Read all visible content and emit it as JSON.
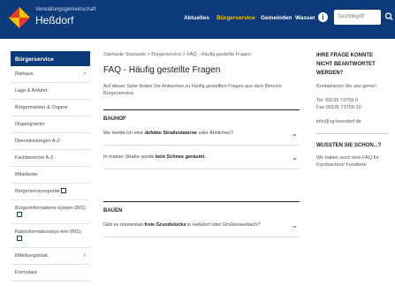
{
  "header": {
    "brand_small": "Verwaltungsgemeinschaft",
    "brand_big": "Heßdorf",
    "nav": [
      "Aktuelles",
      "Bürgerservice",
      "Gemeinden",
      "Wasser"
    ],
    "active_nav": "Bürgerservice",
    "search_placeholder": "Suchbegriff"
  },
  "sidebar": {
    "heading": "Bürgerservice",
    "items": [
      {
        "label": "Rathaus",
        "chevron": true,
        "external": false
      },
      {
        "label": "Lage & Anfahrt",
        "chevron": false,
        "external": false
      },
      {
        "label": "Bürgermeister & Organe",
        "chevron": false,
        "external": false
      },
      {
        "label": "Organigramm",
        "chevron": false,
        "external": false
      },
      {
        "label": "Dienstleistungen A-Z",
        "chevron": false,
        "external": false
      },
      {
        "label": "Fachbereiche A-Z",
        "chevron": false,
        "external": false
      },
      {
        "label": "Mitarbeiter",
        "chevron": false,
        "external": false
      },
      {
        "label": "Bürgerservicesportal",
        "chevron": false,
        "external": true
      },
      {
        "label": "Bürgerinformations-system (BIS)",
        "chevron": false,
        "external": true
      },
      {
        "label": "Ratsinformationssys-tem (RIS)",
        "chevron": false,
        "external": true
      },
      {
        "label": "Mitteilungsblatt",
        "chevron": true,
        "external": false
      },
      {
        "label": "Formulare",
        "chevron": false,
        "external": false
      }
    ]
  },
  "main": {
    "breadcrumb": "Startseite  Startseite  >  Bürgerservice  >  FAQ - Häufig gestellte Fragen",
    "title": "FAQ - Häufig gestellte Fragen",
    "intro": "Auf dieser Seite finden Sie Antworten zu häufig gestellten Fragen aus dem Bereich Bürgerservice.",
    "sections": [
      {
        "title": "BAUHOF",
        "faqs": [
          {
            "pre": "Wo melde ich eine ",
            "bold": "defekte Straßenlaterne",
            "post": " oder Ähnliches?"
          },
          {
            "pre": "In meiner Straße wurde ",
            "bold": "kein Schnee geräumt",
            "post": "..."
          }
        ]
      },
      {
        "title": "BAUEN",
        "faqs": [
          {
            "pre": "Gibt es momentan ",
            "bold": "freie Grundstücke",
            "post": " in Heßdorf oder Großenseebach?"
          }
        ]
      }
    ]
  },
  "right": {
    "contact_title": "IHRE FRAGE KONNTE NICHT BEANTWORTET WERDEN?",
    "contact_text": "Kontaktieren Sie uns gerne!",
    "tel": "Tel. 09135 73759-0",
    "fax": "Fax 09135 73759-10",
    "email": "info@vg-hessdorf.de",
    "know_title": "WUSSTEN SIE SCHON...?",
    "know_text": "Wir haben auch eine FAQ für Fundsachen/ Fundtiere"
  }
}
